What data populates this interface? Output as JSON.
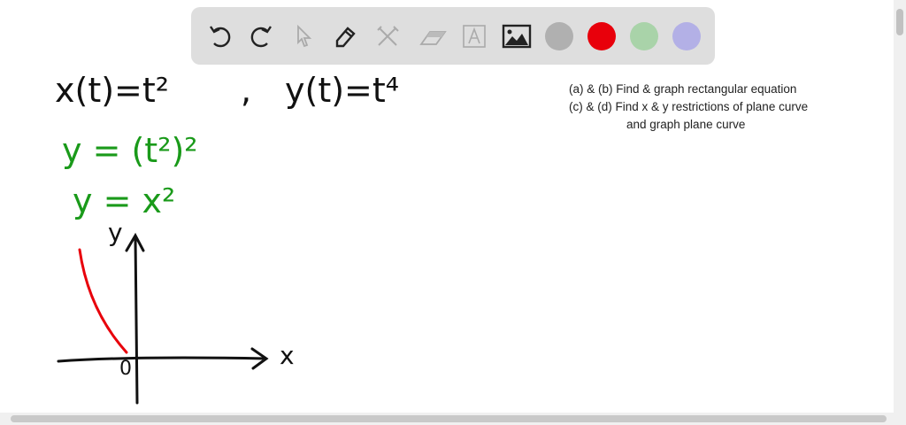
{
  "toolbar": {
    "tools": [
      "undo-icon",
      "redo-icon",
      "pointer-icon",
      "pencil-icon",
      "tools-icon",
      "eraser-icon",
      "text-icon",
      "image-icon"
    ],
    "colors": {
      "gray": "#b0b0b0",
      "red": "#e8000b",
      "green": "#a9d3a9",
      "purple": "#b3b0e6"
    }
  },
  "notes": {
    "line1": "(a) & (b) Find & graph rectangular equation",
    "line2": "(c) & (d) Find x & y restrictions of plane curve",
    "line3": "and graph plane curve"
  },
  "handwriting": {
    "x_eq": "x(t)=t²",
    "comma": ",",
    "y_eq": "y(t)=t⁴",
    "sub1": "y = (t²)²",
    "sub2": "y = x²",
    "y_label": "y",
    "x_label": "x",
    "origin_label": "0"
  }
}
